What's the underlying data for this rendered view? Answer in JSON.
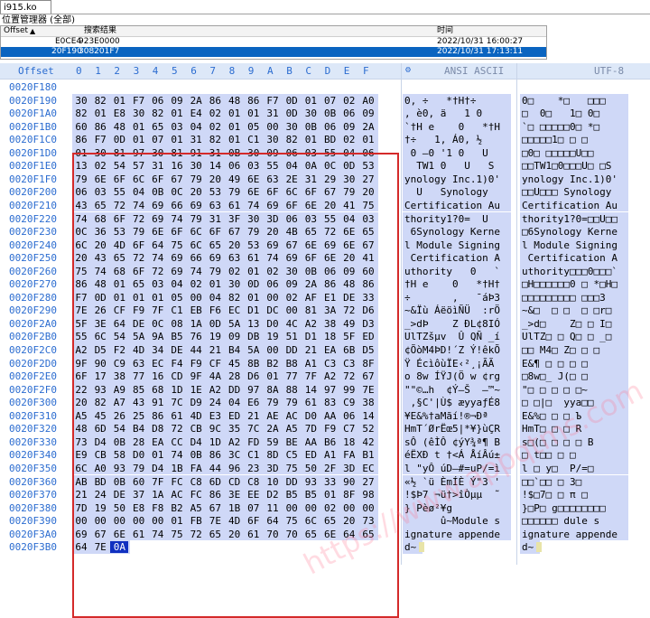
{
  "tab_title": "i915.ko",
  "position_manager": {
    "title": "位置管理器 (全部)",
    "columns": {
      "offset": "Offset",
      "sort_icon": "▲",
      "search_result": "搜索结果",
      "time": "时间"
    },
    "rows": [
      {
        "offset": "E0CE4",
        "result": "923E0000",
        "time": "2022/10/31  16:00:27",
        "selected": false
      },
      {
        "offset": "20F190",
        "result": "308201F7",
        "time": "2022/10/31  17:13:11",
        "selected": true
      }
    ]
  },
  "hex_header": {
    "offset_label": "Offset",
    "columns": [
      "0",
      "1",
      "2",
      "3",
      "4",
      "5",
      "6",
      "7",
      "8",
      "9",
      "A",
      "B",
      "C",
      "D",
      "E",
      "F"
    ],
    "ansi_label": "ANSI ASCII",
    "utf8_label": "UTF-8",
    "ansi_icon": "settings-icon"
  },
  "rows": [
    {
      "addr": "0020F180",
      "hex": [
        "",
        "",
        "",
        "",
        "",
        "",
        "",
        "",
        "",
        "",
        "",
        "",
        "",
        "",
        "",
        ""
      ],
      "ansi": "",
      "utf8": ""
    },
    {
      "addr": "0020F190",
      "hex": [
        "30",
        "82",
        "01",
        "F7",
        "06",
        "09",
        "2A",
        "86",
        "48",
        "86",
        "F7",
        "0D",
        "01",
        "07",
        "02",
        "A0"
      ],
      "ansi": "0‚ ÷   *†H†÷",
      "utf8": "0□    *□   □□□"
    },
    {
      "addr": "0020F1A0",
      "hex": [
        "82",
        "01",
        "E8",
        "30",
        "82",
        "01",
        "E4",
        "02",
        "01",
        "01",
        "31",
        "0D",
        "30",
        "0B",
        "06",
        "09"
      ],
      "ansi": ", è0, ä   1 0",
      "utf8": "□  0□   1□ 0□"
    },
    {
      "addr": "0020F1B0",
      "hex": [
        "60",
        "86",
        "48",
        "01",
        "65",
        "03",
        "04",
        "02",
        "01",
        "05",
        "00",
        "30",
        "0B",
        "06",
        "09",
        "2A"
      ],
      "ansi": "`†H e    0   *†H",
      "utf8": "`□ □□□□□0□ *□"
    },
    {
      "addr": "0020F1C0",
      "hex": [
        "86",
        "F7",
        "0D",
        "01",
        "07",
        "01",
        "31",
        "82",
        "01",
        "C1",
        "30",
        "82",
        "01",
        "BD",
        "02",
        "01"
      ],
      "ansi": "†÷   1, Á0, ½",
      "utf8": "□□□□□1□ □ □"
    },
    {
      "addr": "0020F1D0",
      "hex": [
        "01",
        "30",
        "81",
        "97",
        "30",
        "81",
        "91",
        "31",
        "0B",
        "30",
        "09",
        "06",
        "03",
        "55",
        "04",
        "06"
      ],
      "ansi": " 0 —0 '1 0   U",
      "utf8": "□0□ □□□□□U□□"
    },
    {
      "addr": "0020F1E0",
      "hex": [
        "13",
        "02",
        "54",
        "57",
        "31",
        "16",
        "30",
        "14",
        "06",
        "03",
        "55",
        "04",
        "0A",
        "0C",
        "0D",
        "53"
      ],
      "ansi": "  TW1 0   U   S",
      "utf8": "□□TW1□0□□□U□ □S"
    },
    {
      "addr": "0020F1F0",
      "hex": [
        "79",
        "6E",
        "6F",
        "6C",
        "6F",
        "67",
        "79",
        "20",
        "49",
        "6E",
        "63",
        "2E",
        "31",
        "29",
        "30",
        "27"
      ],
      "ansi": "ynology Inc.1)0'",
      "utf8": "ynology Inc.1)0'"
    },
    {
      "addr": "0020F200",
      "hex": [
        "06",
        "03",
        "55",
        "04",
        "0B",
        "0C",
        "20",
        "53",
        "79",
        "6E",
        "6F",
        "6C",
        "6F",
        "67",
        "79",
        "20"
      ],
      "ansi": "  U   Synology ",
      "utf8": "□□U□□□ Synology "
    },
    {
      "addr": "0020F210",
      "hex": [
        "43",
        "65",
        "72",
        "74",
        "69",
        "66",
        "69",
        "63",
        "61",
        "74",
        "69",
        "6F",
        "6E",
        "20",
        "41",
        "75"
      ],
      "ansi": "Certification Au",
      "utf8": "Certification Au"
    },
    {
      "addr": "0020F220",
      "hex": [
        "74",
        "68",
        "6F",
        "72",
        "69",
        "74",
        "79",
        "31",
        "3F",
        "30",
        "3D",
        "06",
        "03",
        "55",
        "04",
        "03"
      ],
      "ansi": "thority1?0=  U",
      "utf8": "thority1?0=□□U□□"
    },
    {
      "addr": "0020F230",
      "hex": [
        "0C",
        "36",
        "53",
        "79",
        "6E",
        "6F",
        "6C",
        "6F",
        "67",
        "79",
        "20",
        "4B",
        "65",
        "72",
        "6E",
        "65"
      ],
      "ansi": " 6Synology Kerne",
      "utf8": "□6Synology Kerne"
    },
    {
      "addr": "0020F240",
      "hex": [
        "6C",
        "20",
        "4D",
        "6F",
        "64",
        "75",
        "6C",
        "65",
        "20",
        "53",
        "69",
        "67",
        "6E",
        "69",
        "6E",
        "67"
      ],
      "ansi": "l Module Signing",
      "utf8": "l Module Signing"
    },
    {
      "addr": "0020F250",
      "hex": [
        "20",
        "43",
        "65",
        "72",
        "74",
        "69",
        "66",
        "69",
        "63",
        "61",
        "74",
        "69",
        "6F",
        "6E",
        "20",
        "41"
      ],
      "ansi": " Certification A",
      "utf8": " Certification A"
    },
    {
      "addr": "0020F260",
      "hex": [
        "75",
        "74",
        "68",
        "6F",
        "72",
        "69",
        "74",
        "79",
        "02",
        "01",
        "02",
        "30",
        "0B",
        "06",
        "09",
        "60"
      ],
      "ansi": "uthority   0   `",
      "utf8": "uthority□□□0□□□`"
    },
    {
      "addr": "0020F270",
      "hex": [
        "86",
        "48",
        "01",
        "65",
        "03",
        "04",
        "02",
        "01",
        "30",
        "0D",
        "06",
        "09",
        "2A",
        "86",
        "48",
        "86"
      ],
      "ansi": "†H e    0   *†H†",
      "utf8": "□H□□□□□□0 □ *□H□"
    },
    {
      "addr": "0020F280",
      "hex": [
        "F7",
        "0D",
        "01",
        "01",
        "01",
        "05",
        "00",
        "04",
        "82",
        "01",
        "00",
        "02",
        "AF",
        "E1",
        "DE",
        "33"
      ],
      "ansi": "÷       ‚   ¯áÞ3",
      "utf8": "□□□□□□□□□ □□□3"
    },
    {
      "addr": "0020F290",
      "hex": [
        "7E",
        "26",
        "CF",
        "F9",
        "7F",
        "C1",
        "EB",
        "F6",
        "EC",
        "D1",
        "DC",
        "00",
        "81",
        "3A",
        "72",
        "D6"
      ],
      "ansi": "~&Ïù ÁëöìÑÜ  :rÖ",
      "utf8": "~&□  □ □  □ □r□"
    },
    {
      "addr": "0020F2A0",
      "hex": [
        "5F",
        "3E",
        "64",
        "DE",
        "0C",
        "08",
        "1A",
        "0D",
        "5A",
        "13",
        "D0",
        "4C",
        "A2",
        "38",
        "49",
        "D3"
      ],
      "ansi": "_>dÞ    Z ÐL¢8IÓ",
      "utf8": "_>d□    Z□ □ I□"
    },
    {
      "addr": "0020F2B0",
      "hex": [
        "55",
        "6C",
        "54",
        "5A",
        "9A",
        "B5",
        "76",
        "19",
        "09",
        "DB",
        "19",
        "51",
        "D1",
        "18",
        "5F",
        "ED"
      ],
      "ansi": "UlTZšµv  Û QÑ _í",
      "utf8": "UlTZ□ □ Q□ □ _□"
    },
    {
      "addr": "0020F2C0",
      "hex": [
        "A2",
        "D5",
        "F2",
        "4D",
        "34",
        "DE",
        "44",
        "21",
        "B4",
        "5A",
        "00",
        "DD",
        "21",
        "EA",
        "6B",
        "D5"
      ],
      "ansi": "¢ÕòM4ÞD!´Z Ý!êkÕ",
      "utf8": "□□ M4□ Z□ □ □"
    },
    {
      "addr": "0020F2D0",
      "hex": [
        "9F",
        "90",
        "C9",
        "63",
        "EC",
        "F4",
        "F9",
        "CF",
        "45",
        "8B",
        "B2",
        "B8",
        "A1",
        "C3",
        "C3",
        "8F"
      ],
      "ansi": "Ÿ ÉcìôùÏE‹²¸¡ÃÃ",
      "utf8": "E&¶ □ □ □ □"
    },
    {
      "addr": "0020F2E0",
      "hex": [
        "6F",
        "17",
        "38",
        "77",
        "16",
        "CD",
        "9F",
        "4A",
        "28",
        "D6",
        "01",
        "77",
        "7F",
        "A2",
        "72",
        "67"
      ],
      "ansi": "o 8w ÍŸJ(Ö w ¢rg",
      "utf8": "□8w□_ J(□ □"
    },
    {
      "addr": "0020F2F0",
      "hex": [
        "22",
        "93",
        "A9",
        "85",
        "68",
        "1D",
        "1E",
        "A2",
        "DD",
        "97",
        "8A",
        "88",
        "14",
        "97",
        "99",
        "7E"
      ],
      "ansi": "\"\"©…h  ¢Ý—Š  —™~",
      "utf8": "\"□ □ □ □ □~"
    },
    {
      "addr": "0020F300",
      "hex": [
        "20",
        "82",
        "A7",
        "43",
        "91",
        "7C",
        "D9",
        "24",
        "04",
        "E6",
        "79",
        "79",
        "61",
        "83",
        "C9",
        "38"
      ],
      "ansi": " ‚§C'|Ù$ æyyaƒÉ8",
      "utf8": "□ □|□  yya□□"
    },
    {
      "addr": "0020F310",
      "hex": [
        "A5",
        "45",
        "26",
        "25",
        "86",
        "61",
        "4D",
        "E3",
        "ED",
        "21",
        "AE",
        "AC",
        "D0",
        "AA",
        "06",
        "14"
      ],
      "ansi": "¥E&%†aMãí!®¬Ðª",
      "utf8": "E&%□ □ □ Ъ"
    },
    {
      "addr": "0020F320",
      "hex": [
        "48",
        "6D",
        "54",
        "B4",
        "D8",
        "72",
        "CB",
        "9C",
        "35",
        "7C",
        "2A",
        "A5",
        "7D",
        "F9",
        "C7",
        "52"
      ],
      "ansi": "HmT´ØrËœ5|*¥}ùÇR",
      "utf8": "HmT□ □ □ R"
    },
    {
      "addr": "0020F330",
      "hex": [
        "73",
        "D4",
        "0B",
        "28",
        "EA",
        "CC",
        "D4",
        "1D",
        "A2",
        "FD",
        "59",
        "BE",
        "AA",
        "B6",
        "18",
        "42"
      ],
      "ansi": "sÔ (êÌÔ ¢ýY¾ª¶ B",
      "utf8": "s□(□ □ □ □ B"
    },
    {
      "addr": "0020F340",
      "hex": [
        "E9",
        "CB",
        "58",
        "D0",
        "01",
        "74",
        "0B",
        "86",
        "3C",
        "C1",
        "8D",
        "C5",
        "ED",
        "A1",
        "FA",
        "B1"
      ],
      "ansi": "éËXÐ t †<Á ÅíÂú±",
      "utf8": "□ t□□ □ □"
    },
    {
      "addr": "0020F350",
      "hex": [
        "6C",
        "A0",
        "93",
        "79",
        "D4",
        "1B",
        "FA",
        "44",
        "96",
        "23",
        "3D",
        "75",
        "50",
        "2F",
        "3D",
        "EC"
      ],
      "ansi": "l \"yÔ úD–#=uP/=ì",
      "utf8": "l □ y□  P/=□"
    },
    {
      "addr": "0020F360",
      "hex": [
        "AB",
        "BD",
        "0B",
        "60",
        "7F",
        "FC",
        "C8",
        "6D",
        "CD",
        "C8",
        "10",
        "DD",
        "93",
        "33",
        "90",
        "27"
      ],
      "ansi": "«½ `ü ÈmÍÈ Ý\"3 '",
      "utf8": "□□`□□ □ 3□"
    },
    {
      "addr": "0020F370",
      "hex": [
        "21",
        "24",
        "DE",
        "37",
        "1A",
        "AC",
        "FC",
        "86",
        "3E",
        "EE",
        "D2",
        "B5",
        "B5",
        "01",
        "8F",
        "98"
      ],
      "ansi": "!$Þ7 ¬ü†>îÒµµ  ˜",
      "utf8": "!$□7□ □ π □"
    },
    {
      "addr": "0020F380",
      "hex": [
        "7D",
        "19",
        "50",
        "E8",
        "F8",
        "B2",
        "A5",
        "67",
        "1B",
        "07",
        "11",
        "00",
        "00",
        "02",
        "00",
        "00"
      ],
      "ansi": "} Pèø²¥g",
      "utf8": "}□P□ g□□□□□□□□"
    },
    {
      "addr": "0020F390",
      "hex": [
        "00",
        "00",
        "00",
        "00",
        "00",
        "01",
        "FB",
        "7E",
        "4D",
        "6F",
        "64",
        "75",
        "6C",
        "65",
        "20",
        "73"
      ],
      "ansi": "      û~Module s",
      "utf8": "□□□□□□ dule s"
    },
    {
      "addr": "0020F3A0",
      "hex": [
        "69",
        "67",
        "6E",
        "61",
        "74",
        "75",
        "72",
        "65",
        "20",
        "61",
        "70",
        "70",
        "65",
        "6E",
        "64",
        "65"
      ],
      "ansi": "ignature appende",
      "utf8": "ignature appende"
    },
    {
      "addr": "0020F3B0",
      "hex": [
        "64",
        "7E",
        "0A",
        "",
        "",
        "",
        "",
        "",
        "",
        "",
        "",
        "",
        "",
        "",
        "",
        ""
      ],
      "ansi": "d~",
      "utf8": "d~"
    }
  ],
  "watermark": "https://www.appqtms.com"
}
